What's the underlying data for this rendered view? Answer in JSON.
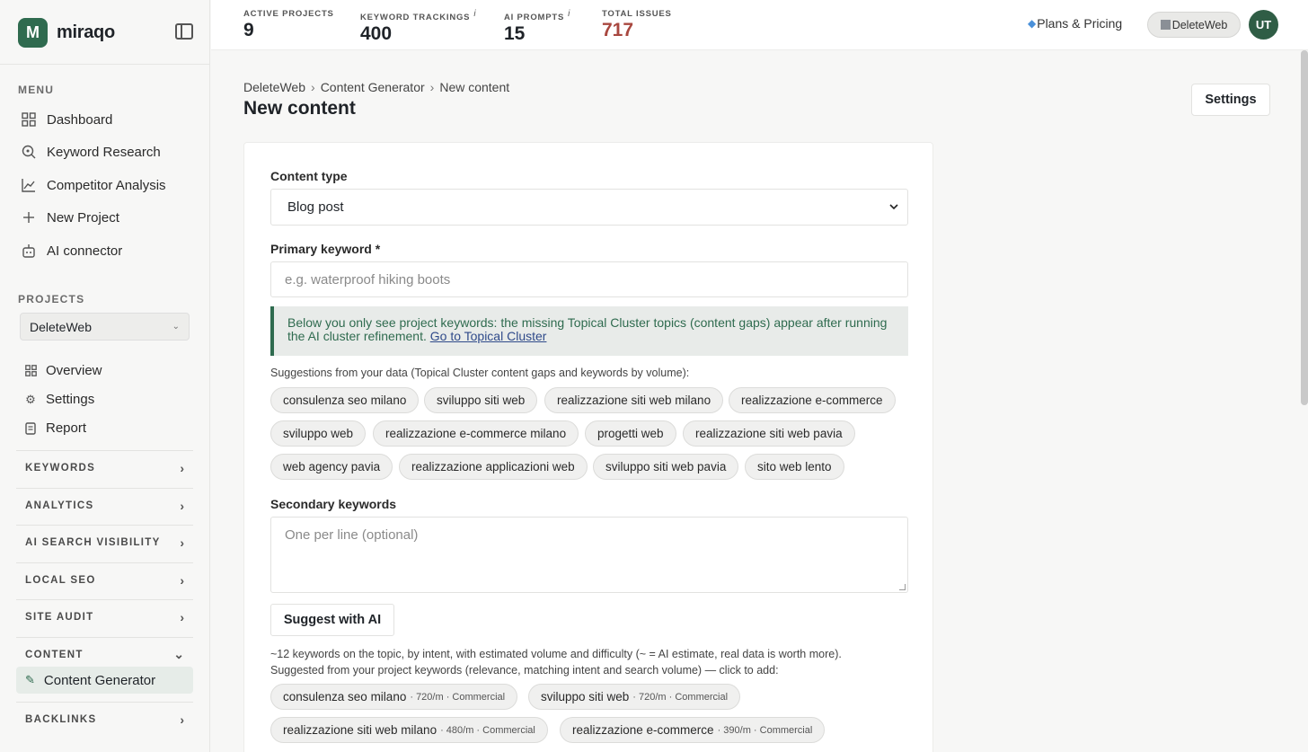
{
  "brand": {
    "name": "miraqo",
    "logo_letter": "M"
  },
  "sidebar": {
    "menu_label": "MENU",
    "menu": [
      {
        "label": "Dashboard",
        "icon": "grid-icon"
      },
      {
        "label": "Keyword Research",
        "icon": "search-icon"
      },
      {
        "label": "Competitor Analysis",
        "icon": "chart-line-icon"
      },
      {
        "label": "New Project",
        "icon": "plus-icon"
      },
      {
        "label": "AI connector",
        "icon": "robot-icon"
      }
    ],
    "projects_label": "PROJECTS",
    "project_selected": "DeleteWeb",
    "project_nav": [
      {
        "label": "Overview",
        "icon": "grid-icon"
      },
      {
        "label": "Settings",
        "icon": "gear-icon"
      },
      {
        "label": "Report",
        "icon": "document-icon"
      }
    ],
    "groups": [
      {
        "label": "KEYWORDS"
      },
      {
        "label": "ANALYTICS"
      },
      {
        "label": "AI SEARCH VISIBILITY"
      },
      {
        "label": "LOCAL SEO"
      },
      {
        "label": "SITE AUDIT"
      },
      {
        "label": "CONTENT"
      },
      {
        "label": "BACKLINKS"
      }
    ],
    "active_item": "Content Generator"
  },
  "topbar": {
    "stats": [
      {
        "label": "ACTIVE PROJECTS",
        "value": "9",
        "info": ""
      },
      {
        "label": "KEYWORD TRACKINGS",
        "value": "400",
        "info": "i"
      },
      {
        "label": "AI PROMPTS",
        "value": "15",
        "info": "i"
      },
      {
        "label": "TOTAL ISSUES",
        "value": "717",
        "info": ""
      }
    ],
    "plans_label": "Plans & Pricing",
    "workspace": "DeleteWeb",
    "avatar_initials": "UT"
  },
  "breadcrumb": [
    "DeleteWeb",
    "Content Generator",
    "New content"
  ],
  "page_title": "New content",
  "settings_button": "Settings",
  "form": {
    "content_type_label": "Content type",
    "content_type_value": "Blog post",
    "primary_keyword_label": "Primary keyword *",
    "primary_keyword_placeholder": "e.g. waterproof hiking boots",
    "notice_text": "Below you only see project keywords: the missing Topical Cluster topics (content gaps) appear after running the AI cluster refinement.",
    "notice_link": "Go to Topical Cluster",
    "suggestions_hint": "Suggestions from your data (Topical Cluster content gaps and keywords by volume):",
    "suggestion_chips": [
      "consulenza seo milano",
      "sviluppo siti web",
      "realizzazione siti web milano",
      "realizzazione e-commerce",
      "sviluppo web",
      "realizzazione e-commerce milano",
      "progetti web",
      "realizzazione siti web pavia",
      "web agency pavia",
      "realizzazione applicazioni web",
      "sviluppo siti web pavia",
      "sito web lento"
    ],
    "secondary_label": "Secondary keywords",
    "secondary_placeholder": "One per line (optional)",
    "suggest_button": "Suggest with AI",
    "desc_line1": "~12 keywords on the topic, by intent, with estimated volume and difficulty (~ = AI estimate, real data is worth more).",
    "desc_line2": "Suggested from your project keywords (relevance, matching intent and search volume) — click to add:",
    "keyword_chips": [
      {
        "kw": "consulenza seo milano",
        "meta": "· 720/m · Commercial"
      },
      {
        "kw": "sviluppo siti web",
        "meta": "· 720/m · Commercial"
      },
      {
        "kw": "realizzazione siti web milano",
        "meta": "· 480/m · Commercial"
      },
      {
        "kw": "realizzazione e-commerce",
        "meta": "· 390/m · Commercial"
      }
    ]
  },
  "colors": {
    "brand": "#2f6b4f",
    "issues": "#a8473f"
  }
}
